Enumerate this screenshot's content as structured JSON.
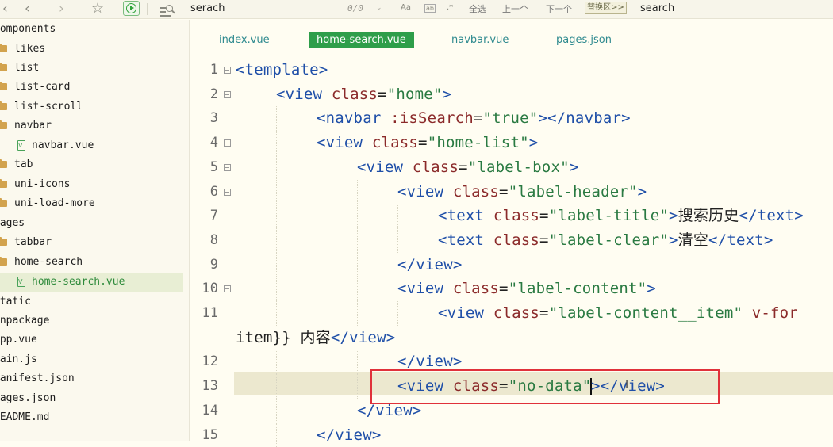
{
  "toolbar": {
    "find_value": "serach",
    "counter": "0/0",
    "opt_case": "Aa",
    "opt_word": "ab",
    "opt_regex": ".*",
    "select_all": "全选",
    "prev": "上一个",
    "next": "下一个",
    "replace_toggle": "替换区>>",
    "replace_value": "search"
  },
  "sidebar": {
    "items": [
      {
        "label": "components",
        "kind": "folder-root"
      },
      {
        "label": "likes",
        "kind": "folder"
      },
      {
        "label": "list",
        "kind": "folder"
      },
      {
        "label": "list-card",
        "kind": "folder"
      },
      {
        "label": "list-scroll",
        "kind": "folder"
      },
      {
        "label": "navbar",
        "kind": "folder"
      },
      {
        "label": "navbar.vue",
        "kind": "vue-file"
      },
      {
        "label": "tab",
        "kind": "folder"
      },
      {
        "label": "uni-icons",
        "kind": "folder"
      },
      {
        "label": "uni-load-more",
        "kind": "folder"
      },
      {
        "label": "pages",
        "kind": "folder-root"
      },
      {
        "label": "tabbar",
        "kind": "folder"
      },
      {
        "label": "home-search",
        "kind": "folder"
      },
      {
        "label": "home-search.vue",
        "kind": "vue-file",
        "selected": true
      },
      {
        "label": "static",
        "kind": "folder-root"
      },
      {
        "label": "unpackage",
        "kind": "folder-root"
      },
      {
        "label": "App.vue",
        "kind": "file"
      },
      {
        "label": "main.js",
        "kind": "file"
      },
      {
        "label": "manifest.json",
        "kind": "file"
      },
      {
        "label": "pages.json",
        "kind": "file"
      },
      {
        "label": "README.md",
        "kind": "file"
      }
    ]
  },
  "tabs": [
    {
      "label": "index.vue"
    },
    {
      "label": "home-search.vue",
      "active": true
    },
    {
      "label": "navbar.vue"
    },
    {
      "label": "pages.json"
    }
  ],
  "editor": {
    "line_numbers": [
      "1",
      "2",
      "3",
      "4",
      "5",
      "6",
      "7",
      "8",
      "9",
      "10",
      "11",
      "12",
      "13",
      "14",
      "15"
    ],
    "lines": [
      [
        [
          "t",
          "<template>"
        ]
      ],
      [
        [
          "t",
          "<view "
        ],
        [
          "a",
          "class"
        ],
        [
          "p",
          "="
        ],
        [
          "s",
          "\"home\""
        ],
        [
          "t",
          ">"
        ]
      ],
      [
        [
          "t",
          "<navbar "
        ],
        [
          "a",
          ":isSearch"
        ],
        [
          "p",
          "="
        ],
        [
          "s",
          "\"true\""
        ],
        [
          "t",
          "></navbar>"
        ]
      ],
      [
        [
          "t",
          "<view "
        ],
        [
          "a",
          "class"
        ],
        [
          "p",
          "="
        ],
        [
          "s",
          "\"home-list\""
        ],
        [
          "t",
          ">"
        ]
      ],
      [
        [
          "t",
          "<view "
        ],
        [
          "a",
          "class"
        ],
        [
          "p",
          "="
        ],
        [
          "s",
          "\"label-box\""
        ],
        [
          "t",
          ">"
        ]
      ],
      [
        [
          "t",
          "<view "
        ],
        [
          "a",
          "class"
        ],
        [
          "p",
          "="
        ],
        [
          "s",
          "\"label-header\""
        ],
        [
          "t",
          ">"
        ]
      ],
      [
        [
          "t",
          "<text "
        ],
        [
          "a",
          "class"
        ],
        [
          "p",
          "="
        ],
        [
          "s",
          "\"label-title\""
        ],
        [
          "t",
          ">"
        ],
        [
          "p",
          "搜索历史"
        ],
        [
          "t",
          "</text>"
        ]
      ],
      [
        [
          "t",
          "<text "
        ],
        [
          "a",
          "class"
        ],
        [
          "p",
          "="
        ],
        [
          "s",
          "\"label-clear\""
        ],
        [
          "t",
          ">"
        ],
        [
          "p",
          "清空"
        ],
        [
          "t",
          "</text>"
        ]
      ],
      [
        [
          "t",
          "</view>"
        ]
      ],
      [
        [
          "t",
          "<view "
        ],
        [
          "a",
          "class"
        ],
        [
          "p",
          "="
        ],
        [
          "s",
          "\"label-content\""
        ],
        [
          "t",
          ">"
        ]
      ],
      [
        [
          "t",
          "<view "
        ],
        [
          "a",
          "class"
        ],
        [
          "p",
          "="
        ],
        [
          "s",
          "\"label-content__item\""
        ],
        [
          "p",
          " "
        ],
        [
          "a",
          "v-for"
        ]
      ],
      [
        [
          "p",
          "item}} 内容"
        ],
        [
          "t",
          "</view>"
        ]
      ],
      [
        [
          "t",
          "</view>"
        ]
      ],
      [
        [
          "t",
          "<view "
        ],
        [
          "a",
          "class"
        ],
        [
          "p",
          "="
        ],
        [
          "s",
          "\"no-data\""
        ],
        [
          "caret",
          ""
        ],
        [
          "t",
          ">"
        ],
        [
          "t",
          "</view>"
        ]
      ],
      [
        [
          "t",
          "</view>"
        ]
      ],
      [
        [
          "t",
          "</view>"
        ]
      ]
    ]
  },
  "colors": {
    "tag": "#1f4fa8",
    "attr": "#8b2a2a",
    "string": "#2a7a42",
    "active_tab": "#2e9e4a",
    "highlight_box": "#e0313a"
  }
}
